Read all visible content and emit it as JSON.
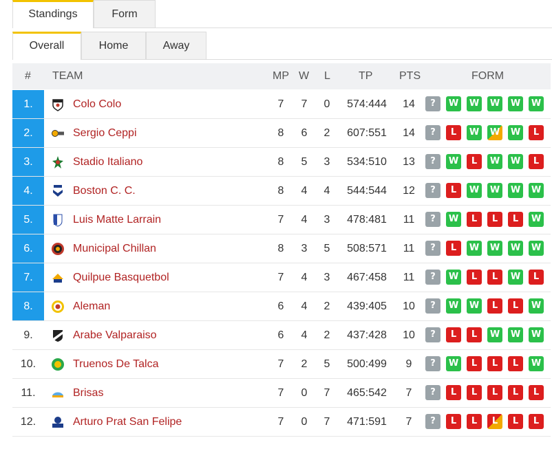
{
  "top_tabs": [
    {
      "label": "Standings",
      "active": true
    },
    {
      "label": "Form",
      "active": false
    }
  ],
  "sub_tabs": [
    {
      "label": "Overall",
      "active": true
    },
    {
      "label": "Home",
      "active": false
    },
    {
      "label": "Away",
      "active": false
    }
  ],
  "columns": {
    "rank": "#",
    "team": "TEAM",
    "mp": "MP",
    "w": "W",
    "l": "L",
    "tp": "TP",
    "pts": "PTS",
    "form": "FORM"
  },
  "colors": {
    "highlight": "#1e9be8",
    "win": "#2bc04a",
    "loss": "#dc1e1e",
    "unknown": "#9aa3a8",
    "live": "#f2a900",
    "team_link": "#b12323"
  },
  "rows": [
    {
      "rank": "1.",
      "team": "Colo Colo",
      "logo": "colo-colo-logo",
      "mp": "7",
      "w": "7",
      "l": "0",
      "tp": "574:444",
      "pts": "14",
      "highlight": true,
      "form": [
        "?",
        "W",
        "W",
        "W",
        "W",
        "W"
      ]
    },
    {
      "rank": "2.",
      "team": "Sergio Ceppi",
      "logo": "sergio-ceppi-logo",
      "mp": "8",
      "w": "6",
      "l": "2",
      "tp": "607:551",
      "pts": "14",
      "highlight": true,
      "form": [
        "?",
        "L",
        "W",
        "W*",
        "W",
        "L"
      ]
    },
    {
      "rank": "3.",
      "team": "Stadio Italiano",
      "logo": "stadio-italiano-logo",
      "mp": "8",
      "w": "5",
      "l": "3",
      "tp": "534:510",
      "pts": "13",
      "highlight": true,
      "form": [
        "?",
        "W",
        "L",
        "W",
        "W",
        "L"
      ]
    },
    {
      "rank": "4.",
      "team": "Boston C. C.",
      "logo": "boston-logo",
      "mp": "8",
      "w": "4",
      "l": "4",
      "tp": "544:544",
      "pts": "12",
      "highlight": true,
      "form": [
        "?",
        "L",
        "W",
        "W",
        "W",
        "W"
      ]
    },
    {
      "rank": "5.",
      "team": "Luis Matte Larrain",
      "logo": "luis-matte-logo",
      "mp": "7",
      "w": "4",
      "l": "3",
      "tp": "478:481",
      "pts": "11",
      "highlight": true,
      "form": [
        "?",
        "W",
        "L",
        "L",
        "L",
        "W"
      ]
    },
    {
      "rank": "6.",
      "team": "Municipal Chillan",
      "logo": "municipal-chillan-logo",
      "mp": "8",
      "w": "3",
      "l": "5",
      "tp": "508:571",
      "pts": "11",
      "highlight": true,
      "form": [
        "?",
        "L",
        "W",
        "W",
        "W",
        "W"
      ]
    },
    {
      "rank": "7.",
      "team": "Quilpue Basquetbol",
      "logo": "quilpue-logo",
      "mp": "7",
      "w": "4",
      "l": "3",
      "tp": "467:458",
      "pts": "11",
      "highlight": true,
      "form": [
        "?",
        "W",
        "L",
        "L",
        "W",
        "L"
      ]
    },
    {
      "rank": "8.",
      "team": "Aleman",
      "logo": "aleman-logo",
      "mp": "6",
      "w": "4",
      "l": "2",
      "tp": "439:405",
      "pts": "10",
      "highlight": true,
      "form": [
        "?",
        "W",
        "W",
        "L",
        "L",
        "W"
      ]
    },
    {
      "rank": "9.",
      "team": "Arabe Valparaiso",
      "logo": "arabe-logo",
      "mp": "6",
      "w": "4",
      "l": "2",
      "tp": "437:428",
      "pts": "10",
      "highlight": false,
      "form": [
        "?",
        "L",
        "L",
        "W",
        "W",
        "W"
      ]
    },
    {
      "rank": "10.",
      "team": "Truenos De Talca",
      "logo": "truenos-logo",
      "mp": "7",
      "w": "2",
      "l": "5",
      "tp": "500:499",
      "pts": "9",
      "highlight": false,
      "form": [
        "?",
        "W",
        "L",
        "L",
        "L",
        "W"
      ]
    },
    {
      "rank": "11.",
      "team": "Brisas",
      "logo": "brisas-logo",
      "mp": "7",
      "w": "0",
      "l": "7",
      "tp": "465:542",
      "pts": "7",
      "highlight": false,
      "form": [
        "?",
        "L",
        "L",
        "L",
        "L",
        "L"
      ]
    },
    {
      "rank": "12.",
      "team": "Arturo Prat San Felipe",
      "logo": "arturo-prat-logo",
      "mp": "7",
      "w": "0",
      "l": "7",
      "tp": "471:591",
      "pts": "7",
      "highlight": false,
      "form": [
        "?",
        "L",
        "L",
        "L*",
        "L",
        "L"
      ]
    }
  ]
}
